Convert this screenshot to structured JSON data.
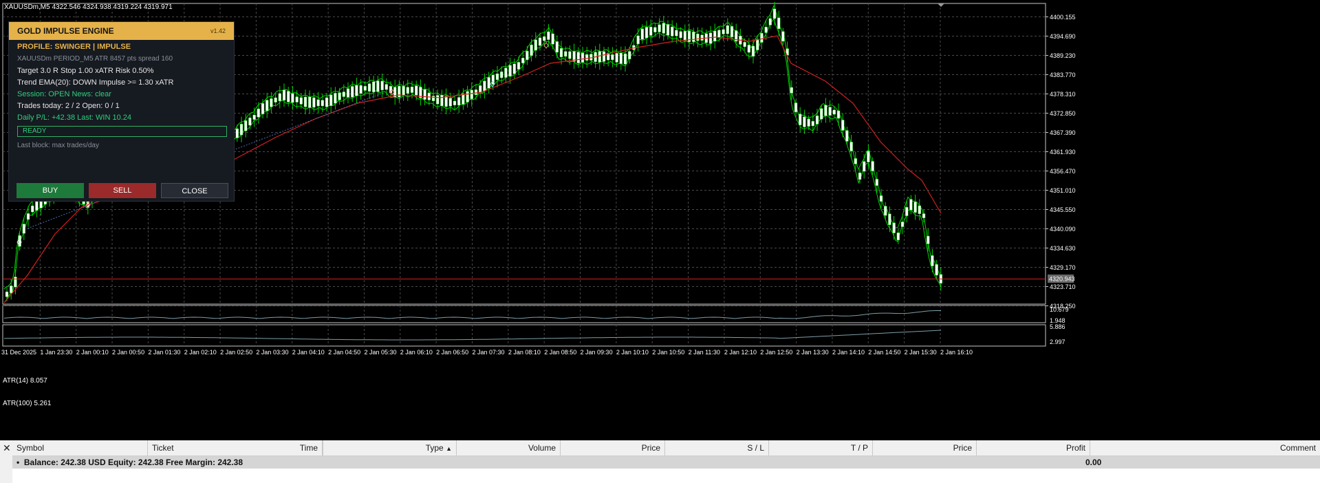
{
  "chart": {
    "info": "XAUUSDm,M5  4322.546 4324.938 4319.224 4319.971",
    "current_price": "4320.943",
    "price_labels": [
      "4400.155",
      "4394.690",
      "4389.230",
      "4383.770",
      "4378.310",
      "4372.850",
      "4367.390",
      "4361.930",
      "4356.470",
      "4351.010",
      "4345.550",
      "4340.090",
      "4334.630",
      "4329.170",
      "4323.710",
      "4318.250"
    ],
    "time_labels": [
      "31 Dec 2025",
      "1 Jan 23:30",
      "2 Jan 00:10",
      "2 Jan 00:50",
      "2 Jan 01:30",
      "2 Jan 02:10",
      "2 Jan 02:50",
      "2 Jan 03:30",
      "2 Jan 04:10",
      "2 Jan 04:50",
      "2 Jan 05:30",
      "2 Jan 06:10",
      "2 Jan 06:50",
      "2 Jan 07:30",
      "2 Jan 08:10",
      "2 Jan 08:50",
      "2 Jan 09:30",
      "2 Jan 10:10",
      "2 Jan 10:50",
      "2 Jan 11:30",
      "2 Jan 12:10",
      "2 Jan 12:50",
      "2 Jan 13:30",
      "2 Jan 14:10",
      "2 Jan 14:50",
      "2 Jan 15:30",
      "2 Jan 16:10"
    ],
    "colors": {
      "candle_up": "#ffffff",
      "candle_border": "#00d600",
      "ema": "#d42020",
      "price_line": "#d42020",
      "grid": "#4a4a4a",
      "atr": "#7f9fa8"
    }
  },
  "atr14": {
    "label": "ATR(14) 8.057",
    "max_label": "10.679",
    "min_label": "1.948"
  },
  "atr100": {
    "label": "ATR(100) 5.261",
    "max_label": "5.886",
    "min_label": "2.997"
  },
  "panel": {
    "title": "GOLD IMPULSE ENGINE",
    "version": "v1.42",
    "profile": "PROFILE: SWINGER   |   IMPULSE",
    "symbol_line": "XAUUSDm PERIOD_M5   ATR 8457 pts   spread 160",
    "target_line": "Target 3.0 R   Stop 1.00 xATR   Risk 0.50%",
    "trend_line": "Trend EMA(20): DOWN    Impulse >= 1.30 xATR",
    "session_line": "Session: OPEN    News: clear",
    "trades_line": "Trades today: 2 / 2    Open: 0 / 1",
    "pl_line": "Daily P/L: +42.38    Last: WIN 10.24",
    "status": "READY",
    "last_block": "Last block: max trades/day",
    "buy_label": "BUY",
    "sell_label": "SELL",
    "close_label": "CLOSE"
  },
  "terminal": {
    "close_glyph": "✕",
    "columns": [
      "Symbol",
      "Ticket",
      "Time",
      "Type",
      "Volume",
      "Price",
      "S / L",
      "T / P",
      "Price",
      "Profit",
      "Comment"
    ],
    "sort_glyph": "▲",
    "balance_line": "Balance: 242.38 USD  Equity: 242.38  Free Margin: 242.38",
    "profit": "0.00"
  }
}
